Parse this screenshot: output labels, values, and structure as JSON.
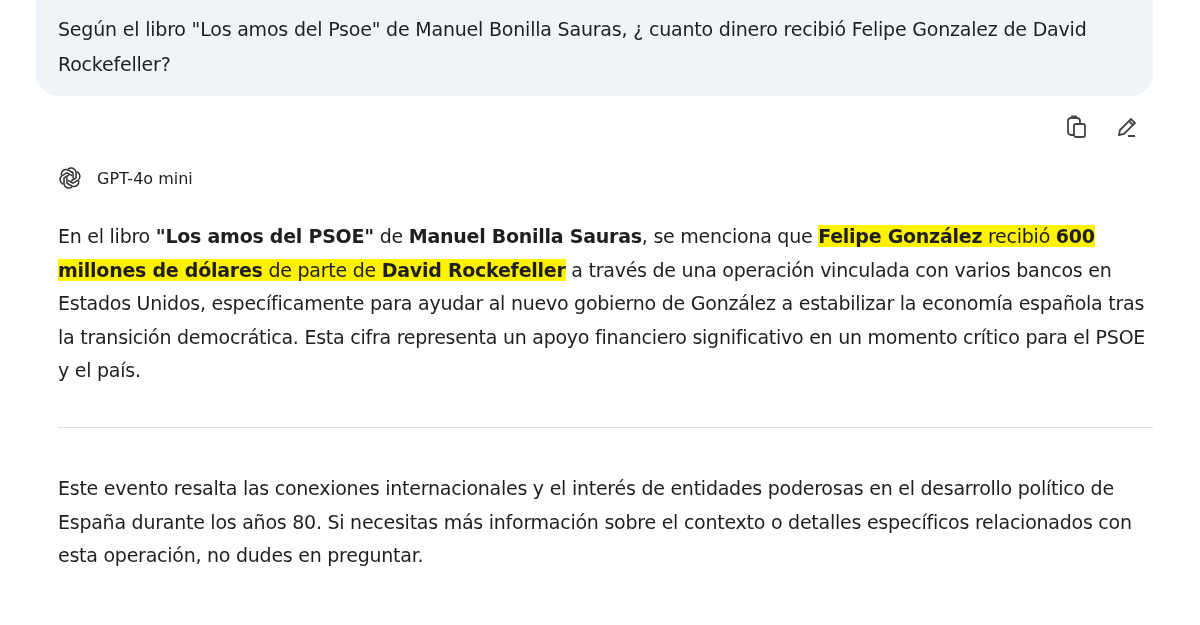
{
  "user_message": {
    "text": "Según el libro \"Los amos del Psoe\" de Manuel Bonilla Sauras, ¿ cuanto dinero recibió Felipe Gonzalez de David Rockefeller?"
  },
  "assistant": {
    "model": "GPT-4o mini",
    "paragraphs": [
      {
        "segments": [
          {
            "text": "En el libro ",
            "bold": false,
            "highlighted": false
          },
          {
            "text": "\"Los amos del PSOE\"",
            "bold": true,
            "highlighted": false
          },
          {
            "text": " de ",
            "bold": false,
            "highlighted": false
          },
          {
            "text": "Manuel Bonilla Sauras",
            "bold": true,
            "highlighted": false
          },
          {
            "text": ", se menciona que ",
            "bold": false,
            "highlighted": false
          },
          {
            "text": "Felipe González",
            "bold": true,
            "highlighted": true
          },
          {
            "text": " recibió ",
            "bold": false,
            "highlighted": true
          },
          {
            "text": "600 millones de dólares",
            "bold": true,
            "highlighted": true
          },
          {
            "text": " de parte de ",
            "bold": false,
            "highlighted": true
          },
          {
            "text": "David Rockefeller",
            "bold": true,
            "highlighted": true
          },
          {
            "text": " a través de una operación vinculada con varios bancos en Estados Unidos, específicamente para ayudar al nuevo gobierno de González a estabilizar la economía española tras la transición democrática. Esta cifra representa un apoyo financiero significativo en un momento crítico para el PSOE y el país.",
            "bold": false,
            "highlighted": false
          }
        ]
      },
      {
        "segments": [
          {
            "text": "Este evento resalta las conexiones internacionales y el interés de entidades poderosas en el desarrollo político de España durante los años 80. Si necesitas más información sobre el contexto o detalles específicos relacionados con esta operación, no dudes en preguntar.",
            "bold": false,
            "highlighted": false
          }
        ]
      }
    ]
  }
}
